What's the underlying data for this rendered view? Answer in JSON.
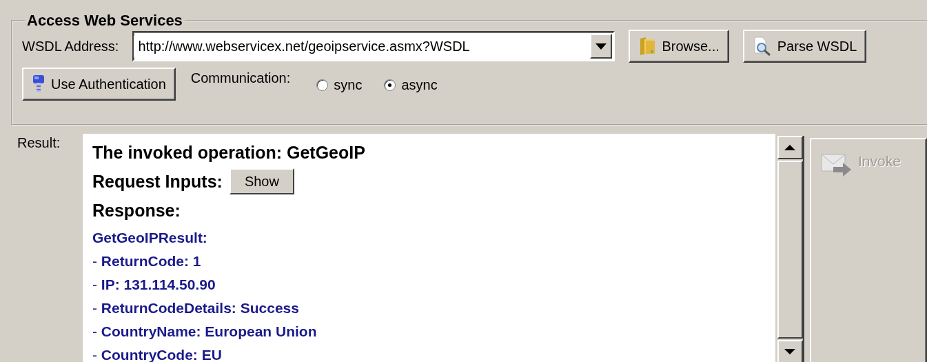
{
  "group": {
    "title": "Access Web Services"
  },
  "wsdl": {
    "label": "WSDL Address:",
    "value": "http://www.webservicex.net/geoipservice.asmx?WSDL",
    "browse_button": "Browse...",
    "parse_button": "Parse WSDL"
  },
  "auth_button": "Use Authentication",
  "communication": {
    "label": "Communication:",
    "options": [
      {
        "label": "sync",
        "selected": false
      },
      {
        "label": "async",
        "selected": true
      }
    ]
  },
  "result": {
    "label": "Result:",
    "operation": "The invoked operation: GetGeoIP",
    "request_inputs": "Request Inputs:",
    "show_button": "Show",
    "response": "Response:",
    "lines": [
      {
        "kind": "heading",
        "text": "GetGeoIPResult:"
      },
      {
        "kind": "field",
        "text": "- **ReturnCode: 1**"
      },
      {
        "kind": "field",
        "text": "- **IP: 131.114.50.90**"
      },
      {
        "kind": "field",
        "text": "- **ReturnCodeDetails: Success**"
      },
      {
        "kind": "field",
        "text": "- **CountryName: European Union**"
      },
      {
        "kind": "field",
        "text": "- **CountryCode: EU**"
      }
    ]
  },
  "invoke_button": {
    "label": "Invoke",
    "disabled": true
  }
}
